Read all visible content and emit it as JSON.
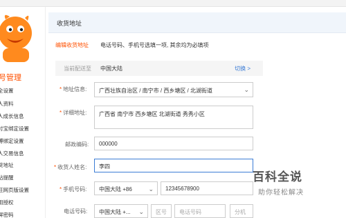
{
  "topbar": {
    "text": "●●●"
  },
  "sidebar": {
    "title": "号管理",
    "items": [
      "全设置",
      "人资料",
      "人成长信息",
      "付宝绑定设置",
      "博绑定设置",
      "人交易信息",
      "货地址",
      "站提醒",
      "旺网页版设置",
      "用授权",
      "屏密码"
    ]
  },
  "section": {
    "title": "收货地址"
  },
  "form": {
    "edit_tab": "编辑收货地址",
    "tip": "电话号码、手机号选填一项, 其余均为必填项",
    "region": {
      "label": "当前配送至",
      "value": "中国大陆",
      "switch": "切换 >"
    },
    "address_info": {
      "label": "地址信息:",
      "value": "广西壮族自治区 / 南宁市 / 西乡塘区 / 北湖街道"
    },
    "detail": {
      "label": "详细地址:",
      "value": "广西省 南宁市 西乡塘区 北湖街道 秀秀小区"
    },
    "postal": {
      "label": "邮政编码:",
      "value": "000000"
    },
    "name": {
      "label": "收货人姓名:",
      "value": "李四"
    },
    "mobile": {
      "label": "手机号码:",
      "country": "中国大陆 +86",
      "value": "12345678900"
    },
    "phone": {
      "label": "电话号码:",
      "country": "中国大陆 +...",
      "area_ph": "区号",
      "number_ph": "电话号码",
      "ext_ph": "分机"
    }
  },
  "watermark": {
    "title": "百科全说",
    "subtitle": "助你轻松解决"
  },
  "colors": {
    "accent": "#ff5000",
    "link": "#3a7bd5",
    "header_bg": "#f0f5fb"
  }
}
